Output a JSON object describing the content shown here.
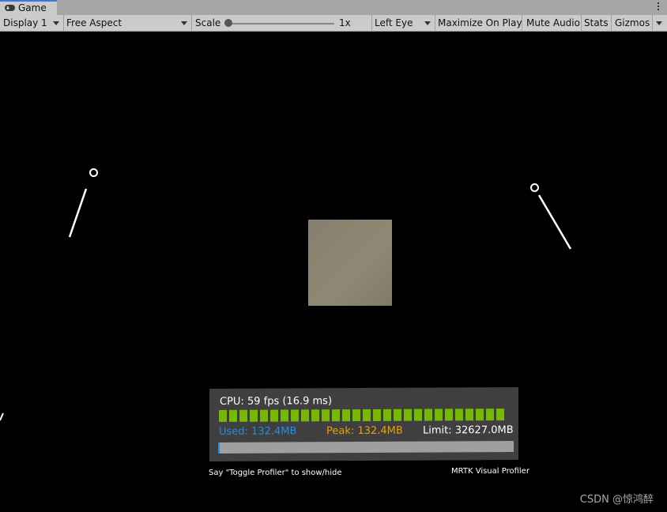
{
  "tab": {
    "icon": "gamepad-icon",
    "label": "Game"
  },
  "toolbar": {
    "display": "Display 1",
    "aspect": "Free Aspect",
    "scale_label": "Scale",
    "scale_value": "1x",
    "eye": "Left Eye",
    "maximize": "Maximize On Play",
    "mute": "Mute Audio",
    "stats": "Stats",
    "gizmos": "Gizmos"
  },
  "profiler": {
    "cpu": "CPU: 59 fps (16.9 ms)",
    "used": "Used: 132.4MB",
    "peak": "Peak: 132.4MB",
    "limit": "Limit: 32627.0MB",
    "frame_bar_count": 28,
    "memory_used_fraction": 0.004,
    "colors": {
      "frame": "#76b900",
      "used": "#1e90e6",
      "peak": "#f0a000",
      "panel": "#3f3f3f"
    },
    "hint": "Say \"Toggle Profiler\" to show/hide",
    "name": "MRTK Visual Profiler"
  },
  "watermark": "CSDN @惊鸿醉"
}
